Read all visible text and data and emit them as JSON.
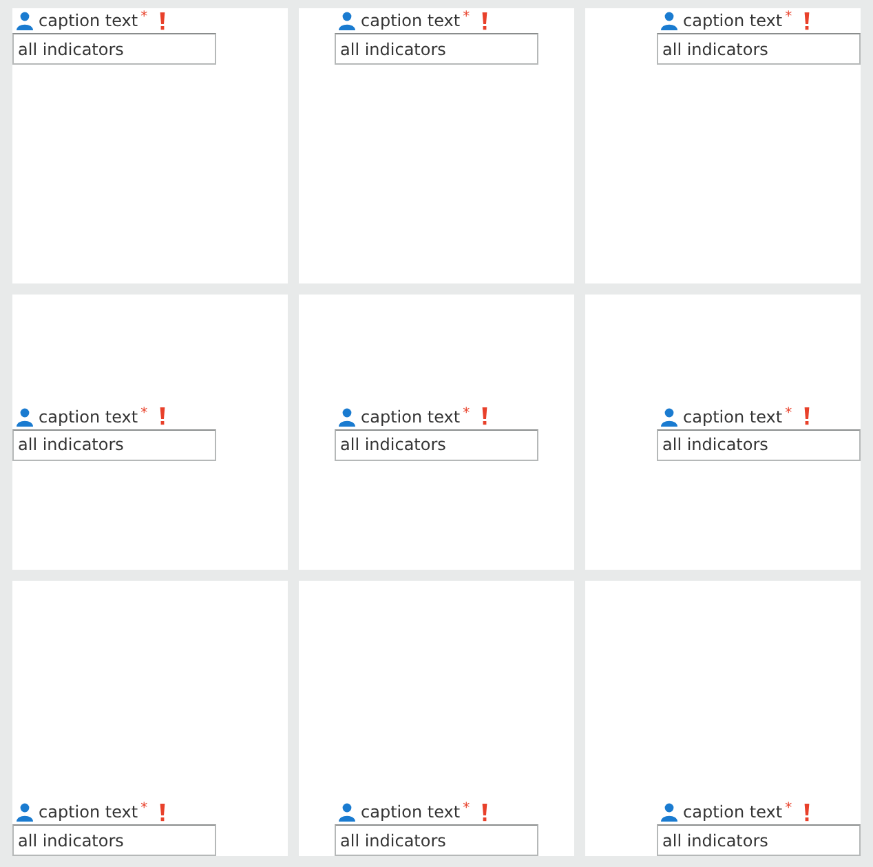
{
  "cells": [
    {
      "kind": "top-left",
      "caption": "caption text",
      "required_mark": "*",
      "error": true,
      "value": "all indicators"
    },
    {
      "kind": "top-center",
      "caption": "caption text",
      "required_mark": "*",
      "error": true,
      "value": "all indicators"
    },
    {
      "kind": "top-right",
      "caption": "caption text",
      "required_mark": "*",
      "error": true,
      "value": "all indicators"
    },
    {
      "kind": "middle-left",
      "caption": "caption text",
      "required_mark": "*",
      "error": true,
      "value": "all indicators"
    },
    {
      "kind": "middle-center",
      "caption": "caption text",
      "required_mark": "*",
      "error": true,
      "value": "all indicators"
    },
    {
      "kind": "middle-right",
      "caption": "caption text",
      "required_mark": "*",
      "error": true,
      "value": "all indicators"
    },
    {
      "kind": "bottom-left",
      "caption": "caption text",
      "required_mark": "*",
      "error": true,
      "value": "all indicators"
    },
    {
      "kind": "bottom-center",
      "caption": "caption text",
      "required_mark": "*",
      "error": true,
      "value": "all indicators"
    },
    {
      "kind": "bottom-right",
      "caption": "caption text",
      "required_mark": "*",
      "error": true,
      "value": "all indicators"
    }
  ]
}
